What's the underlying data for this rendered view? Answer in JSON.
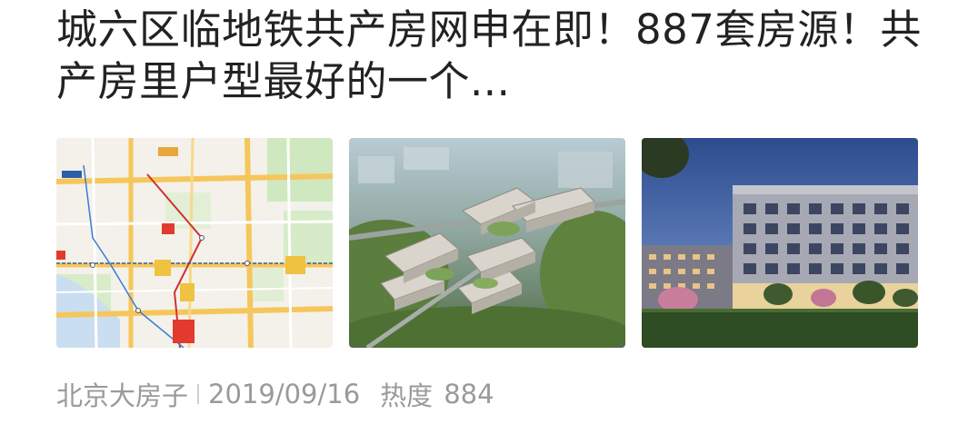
{
  "article": {
    "title": "城六区临地铁共产房网申在即！887套房源！共产房里户型最好的一个...",
    "source": "北京大房子",
    "date": "2019/09/16",
    "heat_label": "热度",
    "heat_value": "884"
  },
  "thumbnails": [
    {
      "name": "map-thumbnail",
      "kind": "map"
    },
    {
      "name": "aerial-render-thumbnail",
      "kind": "aerial-rendering"
    },
    {
      "name": "building-render-thumbnail",
      "kind": "building-rendering"
    }
  ],
  "colors": {
    "title": "#222222",
    "meta": "#9a9a9a",
    "map_road": "#f6c65c",
    "map_marker_red": "#e23a2e",
    "map_marker_orange": "#e8a73a"
  }
}
